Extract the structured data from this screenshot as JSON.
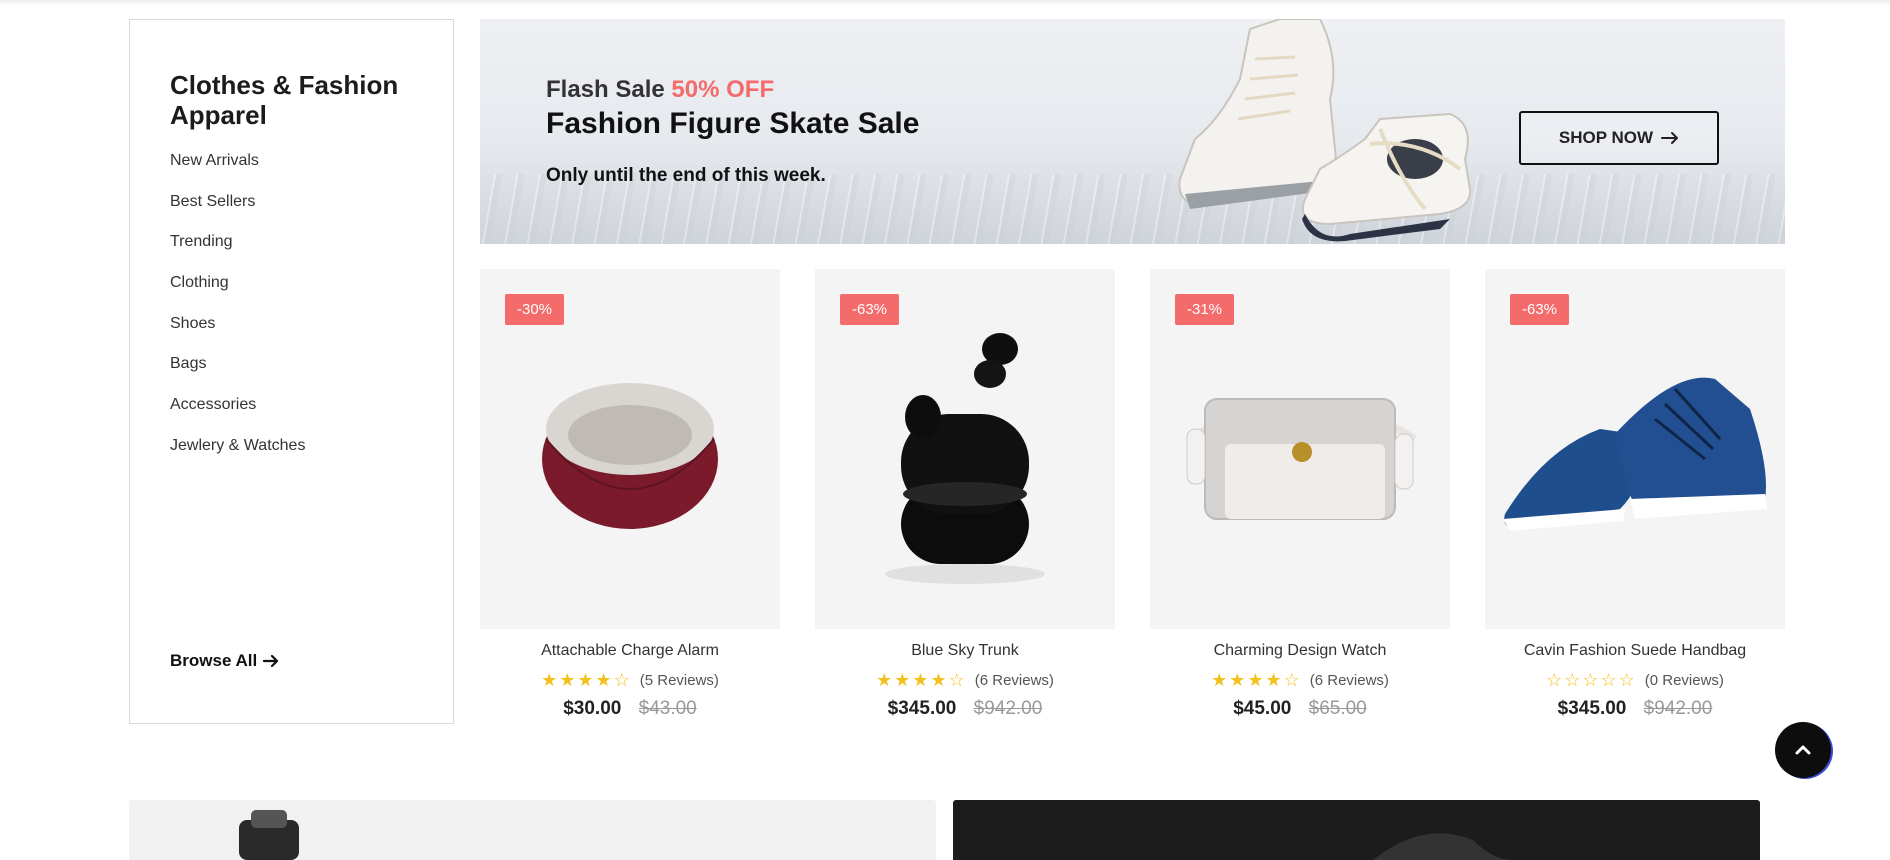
{
  "sidebar": {
    "title": "Clothes & Fashion Apparel",
    "items": [
      {
        "label": "New Arrivals"
      },
      {
        "label": "Best Sellers"
      },
      {
        "label": "Trending"
      },
      {
        "label": "Clothing"
      },
      {
        "label": "Shoes"
      },
      {
        "label": "Bags"
      },
      {
        "label": "Accessories"
      },
      {
        "label": "Jewlery & Watches"
      }
    ],
    "browse_label": "Browse All"
  },
  "banner": {
    "flash_prefix": "Flash Sale",
    "discount": "50% OFF",
    "title": "Fashion Figure Skate Sale",
    "subtitle": "Only until the end of this week.",
    "button_label": "SHOP NOW"
  },
  "products": [
    {
      "badge": "-30%",
      "name": "Attachable Charge Alarm",
      "rating": 4,
      "reviews": "(5 Reviews)",
      "price": "$30.00",
      "old_price": "$43.00"
    },
    {
      "badge": "-63%",
      "name": "Blue Sky Trunk",
      "rating": 4,
      "reviews": "(6 Reviews)",
      "price": "$345.00",
      "old_price": "$942.00"
    },
    {
      "badge": "-31%",
      "name": "Charming Design Watch",
      "rating": 4,
      "reviews": "(6 Reviews)",
      "price": "$45.00",
      "old_price": "$65.00"
    },
    {
      "badge": "-63%",
      "name": "Cavin Fashion Suede Handbag",
      "rating": 0,
      "reviews": "(0 Reviews)",
      "price": "$345.00",
      "old_price": "$942.00"
    }
  ],
  "colors": {
    "accent": "#f46b6b",
    "star": "#f1c21b",
    "text": "#222222"
  },
  "icons": [
    "arrow-right-icon",
    "chevron-up-icon",
    "star-icon"
  ]
}
